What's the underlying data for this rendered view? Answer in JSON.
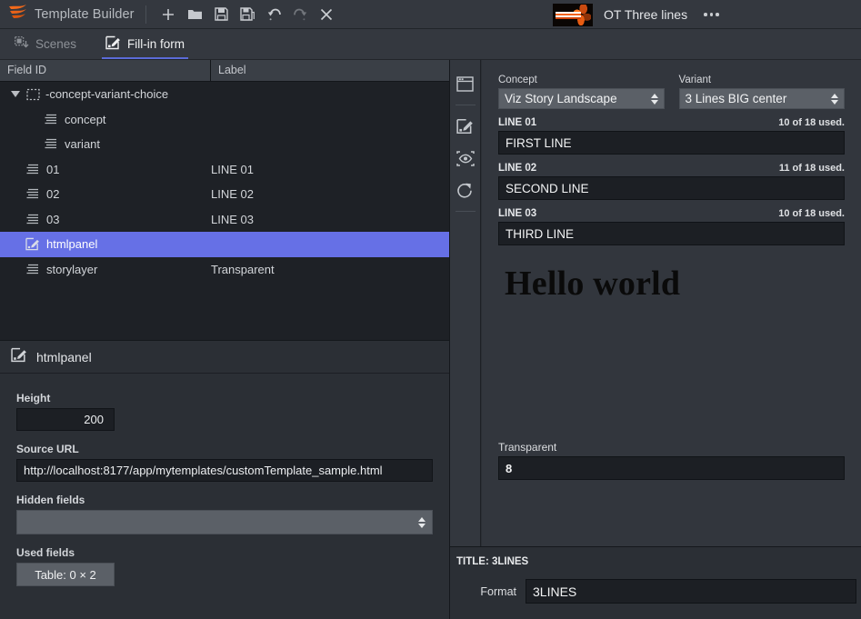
{
  "titlebar": {
    "app_name": "Template Builder",
    "logo_icon": "vizrt-logo-icon",
    "buttons": [
      {
        "name": "new",
        "icon": "plus-icon",
        "label": "+",
        "disabled": false
      },
      {
        "name": "open",
        "icon": "folder-open-icon",
        "label": "Open",
        "disabled": false
      },
      {
        "name": "save",
        "icon": "save-floppy-icon",
        "label": "Save",
        "disabled": false
      },
      {
        "name": "save-as",
        "icon": "save-as-floppy-icon",
        "label": "Save As",
        "disabled": false
      },
      {
        "name": "undo",
        "icon": "undo-arrow-icon",
        "label": "Undo",
        "disabled": false
      },
      {
        "name": "redo",
        "icon": "redo-arrow-icon",
        "label": "Redo",
        "disabled": true
      },
      {
        "name": "close",
        "icon": "close-x-icon",
        "label": "Close",
        "disabled": false
      }
    ],
    "document_name": "OT Three lines",
    "thumbnail_icon": "document-thumbnail",
    "overflow_icon": "more-dots-icon"
  },
  "tabs": [
    {
      "label": "Scenes",
      "icon": "scenes-icon",
      "active": false
    },
    {
      "label": "Fill-in form",
      "icon": "fill-in-form-icon",
      "active": true
    }
  ],
  "tree": {
    "columns": [
      "Field ID",
      "Label"
    ],
    "rows": [
      {
        "id": "-concept-variant-choice",
        "label": "",
        "indent": 0,
        "icon": "group-dashed-icon",
        "expanded": true,
        "selected": false
      },
      {
        "id": "concept",
        "label": "",
        "indent": 2,
        "icon": "text-lines-icon",
        "selected": false
      },
      {
        "id": "variant",
        "label": "",
        "indent": 2,
        "icon": "text-lines-icon",
        "selected": false
      },
      {
        "id": "01",
        "label": "LINE 01",
        "indent": 1,
        "icon": "text-lines-icon",
        "selected": false
      },
      {
        "id": "02",
        "label": "LINE 02",
        "indent": 1,
        "icon": "text-lines-icon",
        "selected": false
      },
      {
        "id": "03",
        "label": "LINE 03",
        "indent": 1,
        "icon": "text-lines-icon",
        "selected": false
      },
      {
        "id": "htmlpanel",
        "label": "",
        "indent": 1,
        "icon": "html-panel-icon",
        "selected": true
      },
      {
        "id": "storylayer",
        "label": "Transparent",
        "indent": 1,
        "icon": "text-lines-icon",
        "selected": false
      }
    ]
  },
  "properties": {
    "title": "htmlpanel",
    "title_icon": "html-panel-icon",
    "height_label": "Height",
    "height_value": "200",
    "source_url_label": "Source URL",
    "source_url_value": "http://localhost:8177/app/mytemplates/customTemplate_sample.html",
    "hidden_fields_label": "Hidden fields",
    "hidden_fields_value": "",
    "used_fields_label": "Used fields",
    "used_fields_button": "Table: 0 × 2"
  },
  "rail": [
    {
      "name": "panel-layout",
      "icon": "window-panel-icon"
    },
    {
      "name": "edit-form",
      "icon": "edit-pencil-icon"
    },
    {
      "name": "preview-eye",
      "icon": "preview-eye-icon"
    },
    {
      "name": "refresh",
      "icon": "refresh-circle-icon"
    }
  ],
  "form": {
    "concept": {
      "label": "Concept",
      "value": "Viz Story Landscape"
    },
    "variant": {
      "label": "Variant",
      "value": "3 Lines BIG center"
    },
    "lines": [
      {
        "name": "LINE 01",
        "used": "10 of 18 used.",
        "value": "FIRST LINE"
      },
      {
        "name": "LINE 02",
        "used": "11 of 18 used.",
        "value": "SECOND LINE"
      },
      {
        "name": "LINE 03",
        "used": "10 of 18 used.",
        "value": "THIRD LINE"
      }
    ],
    "preview_text": "Hello world",
    "transparent": {
      "label": "Transparent",
      "value": "8"
    }
  },
  "bottom": {
    "title": "TITLE: 3LINES",
    "format_label": "Format",
    "format_value": "3LINES"
  },
  "colors": {
    "accent_blue": "#5b6bd8",
    "selection_blue": "#6670e6",
    "logo_orange": "#f2691a",
    "panel_bg": "#2b2f35",
    "tree_bg": "#1e2126",
    "input_bg": "#1c1f24",
    "select_bg": "#5b6067"
  }
}
